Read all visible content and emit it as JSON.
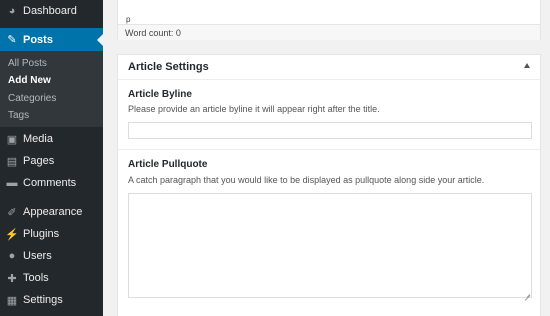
{
  "sidebar": {
    "dashboard": {
      "label": "Dashboard",
      "icon": "dashboard-icon"
    },
    "posts": {
      "label": "Posts",
      "icon": "pushpin-icon"
    },
    "submenu": [
      "All Posts",
      "Add New",
      "Categories",
      "Tags"
    ],
    "media": {
      "label": "Media",
      "icon": "media-icon"
    },
    "pages": {
      "label": "Pages",
      "icon": "pages-icon"
    },
    "comments": {
      "label": "Comments",
      "icon": "comment-icon"
    },
    "appearance": {
      "label": "Appearance",
      "icon": "paintbrush-icon"
    },
    "plugins": {
      "label": "Plugins",
      "icon": "plugin-icon"
    },
    "users": {
      "label": "Users",
      "icon": "user-icon"
    },
    "tools": {
      "label": "Tools",
      "icon": "wrench-icon"
    },
    "settings": {
      "label": "Settings",
      "icon": "settings-icon"
    }
  },
  "editor": {
    "path": "p",
    "word_count": "Word count: 0"
  },
  "article_settings": {
    "title": "Article Settings",
    "byline": {
      "label": "Article Byline",
      "description": "Please provide an article byline it will appear right after the title.",
      "value": ""
    },
    "pullquote": {
      "label": "Article Pullquote",
      "description": "A catch paragraph that you would like to be displayed as pullquote along side your article.",
      "value": ""
    }
  },
  "colors": {
    "sidebar_bg": "#23282d",
    "active_bg": "#0073aa",
    "content_bg": "#f1f1f1"
  }
}
